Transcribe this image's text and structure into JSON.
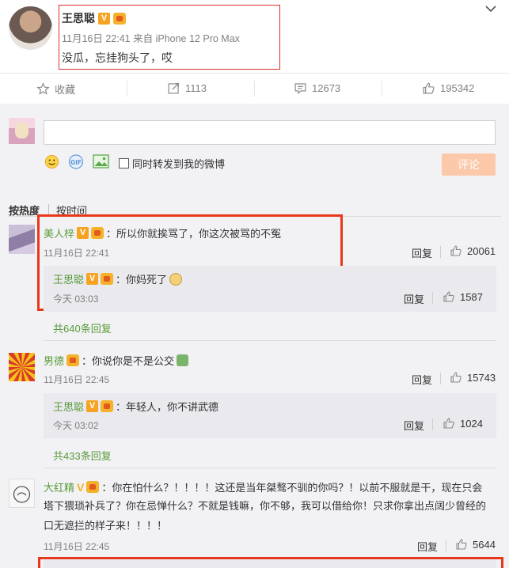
{
  "post": {
    "author": "王思聪",
    "meta": "11月16日 22:41 来自 iPhone 12 Pro Max",
    "text": "没瓜，忘挂狗头了，哎"
  },
  "actions": {
    "favorite_label": "收藏",
    "repost_count": "1113",
    "comment_count": "12673",
    "like_count": "195342"
  },
  "composer": {
    "input_placeholder": "",
    "sync_label": "同时转发到我的微博",
    "submit_label": "评论"
  },
  "sort": {
    "by_hot": "按热度",
    "by_time": "按时间"
  },
  "comments": [
    {
      "author": "美人梓",
      "text": "：所以你就挨骂了，你这次被骂的不冤",
      "time": "11月16日 22:41",
      "reply_label": "回复",
      "likes": "20061",
      "sub_reply": {
        "author": "王思聪",
        "text": "：你妈死了",
        "time": "今天 03:03",
        "reply_label": "回复",
        "likes": "1587"
      },
      "more": "共640条回复"
    },
    {
      "author": "男德",
      "text": "：你说你是不是公交",
      "time": "11月16日 22:45",
      "reply_label": "回复",
      "likes": "15743",
      "sub_reply": {
        "author": "王思聪",
        "text": "：年轻人，你不讲武德",
        "time": "今天 03:02",
        "reply_label": "回复",
        "likes": "1024"
      },
      "more": "共433条回复"
    },
    {
      "author": "大红精",
      "text_line1": "：你在怕什么？！！！！这还是当年桀骜不驯的你吗？！以前不服就是干，现在只会",
      "text_line2": "塔下猥琐补兵了？你在忌惮什么？不就是钱嘛，你不够，我可以借给你！只求你拿出点阔少曾经的",
      "text_line3": "口无遮拦的样子来！！！！",
      "time": "11月16日 22:45",
      "reply_label": "回复",
      "likes": "5644"
    }
  ],
  "colors": {
    "highlight_red": "#e8381c",
    "link_orange": "#eb7350",
    "accent_green": "#5a9b3b",
    "submit_button": "#fbc8a9"
  }
}
